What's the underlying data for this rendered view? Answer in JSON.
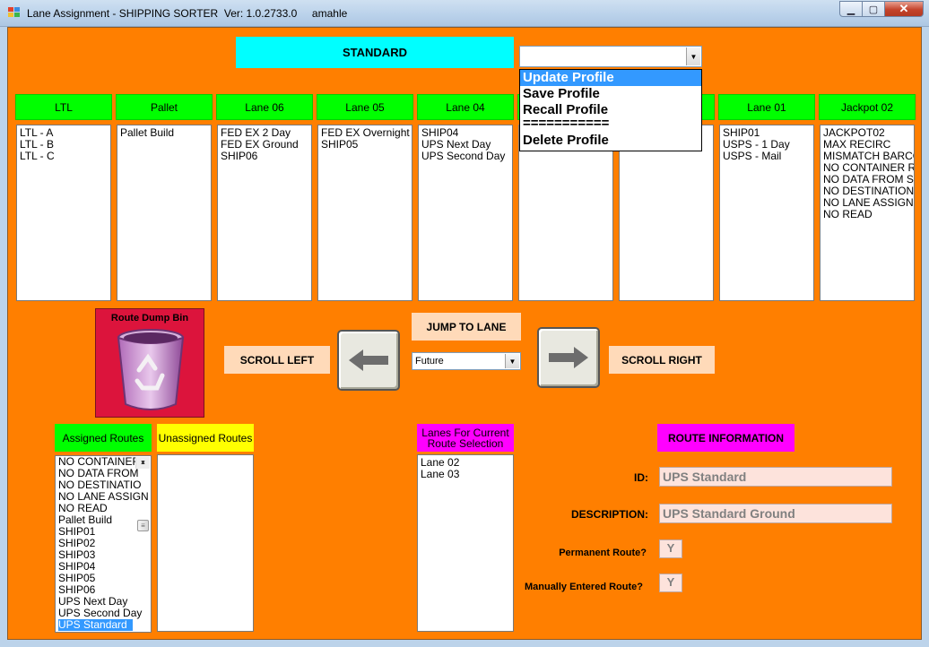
{
  "window": {
    "title": "Lane Assignment - SHIPPING SORTER  Ver: 1.0.2733.0     amahle",
    "minimize_symbol": "▁",
    "maximize_symbol": "▢",
    "close_symbol": "✕"
  },
  "profile": {
    "name": "STANDARD",
    "dropdown_value": "",
    "menu": [
      "Update Profile",
      "Save Profile",
      "Recall Profile",
      "===========",
      "Delete Profile"
    ],
    "menu_selected_index": 0
  },
  "lanes": [
    {
      "title": "LTL",
      "items": [
        "LTL - A",
        "LTL - B",
        "LTL - C"
      ]
    },
    {
      "title": "Pallet",
      "items": [
        "Pallet Build"
      ]
    },
    {
      "title": "Lane 06",
      "items": [
        "FED EX 2 Day",
        "FED EX Ground",
        "SHIP06"
      ]
    },
    {
      "title": "Lane 05",
      "items": [
        "FED EX Overnight",
        "SHIP05"
      ]
    },
    {
      "title": "Lane 04",
      "items": [
        "SHIP04",
        "UPS Next Day",
        "UPS Second Day"
      ]
    },
    {
      "title": "",
      "items": []
    },
    {
      "title": "",
      "items": []
    },
    {
      "title": "Lane 01",
      "items": [
        "SHIP01",
        "USPS - 1 Day",
        "USPS - Mail"
      ]
    },
    {
      "title": "Jackpot 02",
      "items": [
        "JACKPOT02",
        "MAX RECIRC",
        "MISMATCH BARCODE",
        "NO CONTAINER RECORD",
        "NO DATA FROM SCANNER",
        "NO DESTINATION",
        "NO LANE ASSIGNED",
        "NO READ"
      ]
    }
  ],
  "controls": {
    "route_dump_bin": "Route Dump Bin",
    "jump_to_lane": "JUMP TO LANE",
    "scroll_left": "SCROLL LEFT",
    "scroll_right": "SCROLL RIGHT",
    "jump_select_value": "Future"
  },
  "assigned_routes": {
    "label": "Assigned Routes",
    "items": [
      "NO CONTAINER",
      "NO DATA FROM",
      "NO DESTINATIO",
      "NO LANE ASSIGN",
      "NO READ",
      "Pallet Build",
      "SHIP01",
      "SHIP02",
      "SHIP03",
      "SHIP04",
      "SHIP05",
      "SHIP06",
      "UPS Next Day",
      "UPS Second Day",
      "UPS Standard"
    ],
    "selected_index": 14
  },
  "unassigned_routes": {
    "label": "Unassigned Routes",
    "items": []
  },
  "lanes_for_route": {
    "label_line1": "Lanes For Current",
    "label_line2": "Route Selection",
    "items": [
      "Lane 02",
      "Lane 03"
    ]
  },
  "route_info": {
    "header": "ROUTE INFORMATION",
    "id_label": "ID:",
    "id_value": "UPS Standard",
    "description_label": "DESCRIPTION:",
    "description_value": "UPS Standard Ground",
    "permanent_label": "Permanent Route?",
    "permanent_value": "Y",
    "manual_label": "Manually Entered Route?",
    "manual_value": "Y"
  },
  "colors": {
    "background": "#ff7f00",
    "lane_header": "#00ff00",
    "profile_button": "#00ffff",
    "route_info_header": "#ff00ff",
    "dump_bin": "#dc143c"
  },
  "icons": {
    "app": "app-icon",
    "trash": "recycle-bin-icon",
    "left": "arrow-left-icon",
    "right": "arrow-right-icon"
  }
}
